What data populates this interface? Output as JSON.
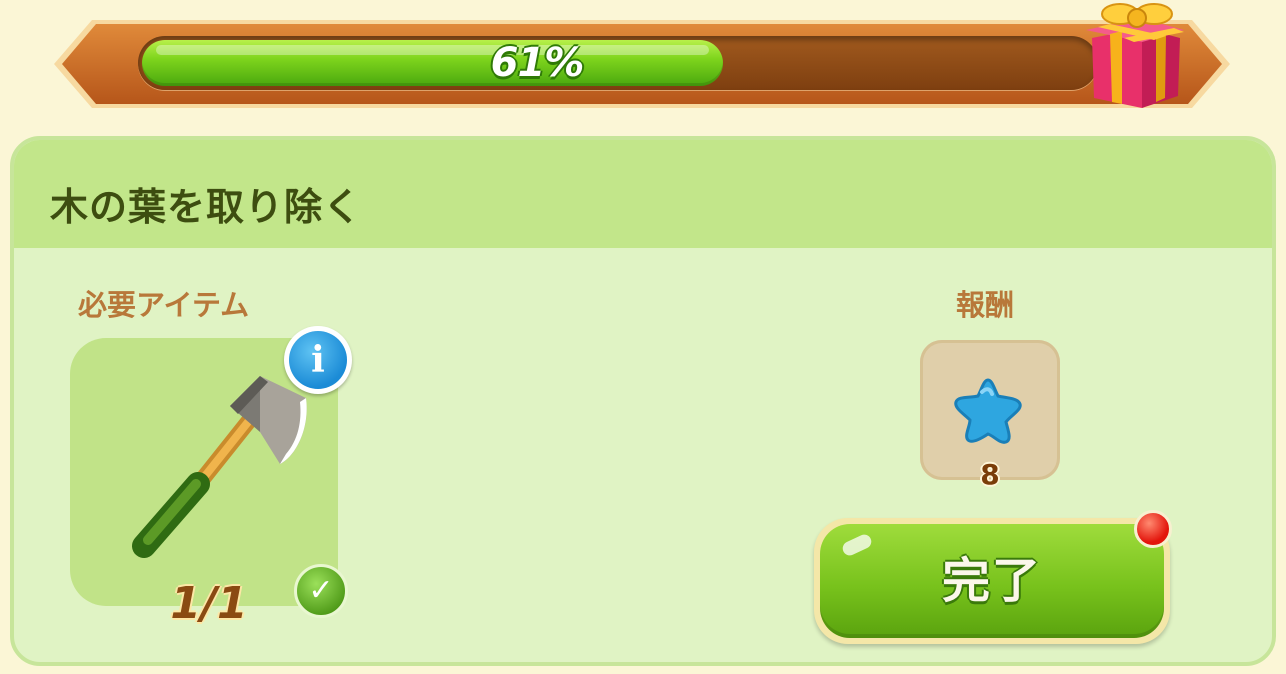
{
  "progress": {
    "percent": 61,
    "label": "61%"
  },
  "task": {
    "title": "木の葉を取り除く"
  },
  "required": {
    "label": "必要アイテム",
    "item_icon": "axe-icon",
    "count_label": "1/1",
    "info_icon_glyph": "i",
    "check_icon_glyph": "✓"
  },
  "reward": {
    "label": "報酬",
    "item_icon": "blue-star-icon",
    "count": "8"
  },
  "complete_button": {
    "label": "完了"
  },
  "colors": {
    "progress_fill": "#7fd51d",
    "frame_brown": "#c0651e",
    "panel_bg": "#e0f3c4",
    "header_bg": "#c2e68a",
    "title_text": "#3d4d10",
    "section_label": "#b8783a",
    "button_green": "#78c21c",
    "notify_red": "#e3150c",
    "star_blue": "#2ea6e0"
  }
}
